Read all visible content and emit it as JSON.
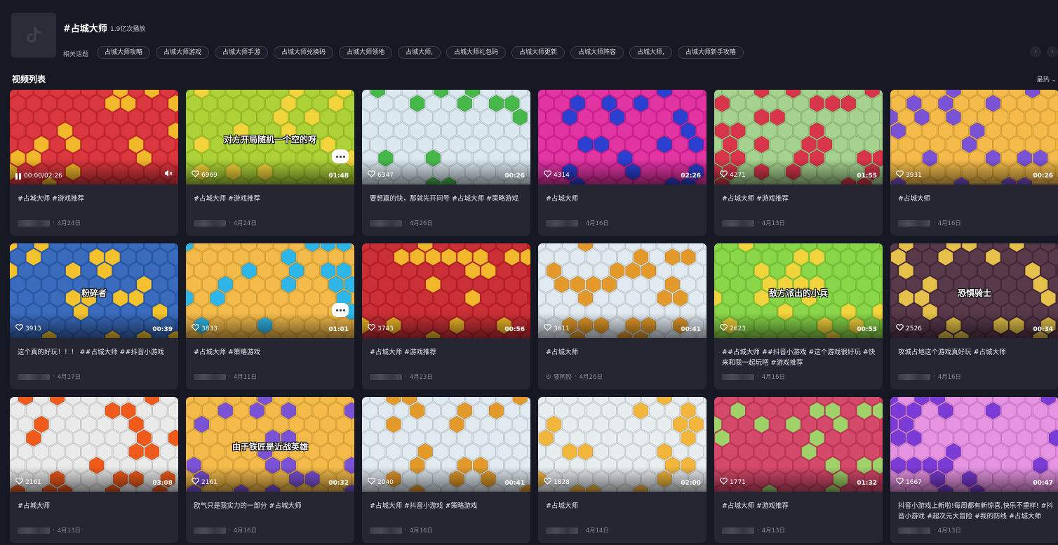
{
  "topic": {
    "title": "#占城大师",
    "plays": "1.9亿次播放",
    "related_label": "相关话题",
    "related_tags": [
      "占城大师攻略",
      "占城大师游戏",
      "占城大师手游",
      "占城大师兑换码",
      "占城大师领地",
      "占城大师,",
      "占城大师礼包码",
      "占城大师更新",
      "占城大师阵容",
      "占城大师,",
      "占城大师新手攻略"
    ],
    "prev_icon": "chevron-left-icon",
    "next_icon": "chevron-right-icon"
  },
  "section": {
    "title": "视频列表",
    "sort_label": "最热 ⌄"
  },
  "videos": [
    {
      "likes": "",
      "duration": "",
      "time": "00:00/02:26",
      "caption": "#占城大师 #游戏推荐",
      "author": "",
      "date": "4月24日",
      "overlay": "",
      "bg": "#d7262e",
      "accent": "#f0b82a",
      "playing": true,
      "bubble": false
    },
    {
      "likes": "6969",
      "duration": "01:48",
      "caption": "#占城大师 #游戏推荐",
      "author": "",
      "date": "4月24日",
      "overlay": "对方开局随机一个空的呀",
      "bg": "#a6cf28",
      "accent": "#f1d33b",
      "playing": false,
      "bubble": true
    },
    {
      "likes": "6347",
      "duration": "00:26",
      "caption": "要想赢的快，那就先开问号 #占城大师 #策略游戏",
      "author": "",
      "date": "4月26日",
      "overlay": "",
      "bg": "#d8e6ee",
      "accent": "#46b84a",
      "playing": false,
      "bubble": false
    },
    {
      "likes": "4314",
      "duration": "02:26",
      "caption": "#占城大师",
      "author": "",
      "date": "4月16日",
      "overlay": "",
      "bg": "#e0239c",
      "accent": "#2b3fd1",
      "playing": false,
      "bubble": false
    },
    {
      "likes": "4271",
      "duration": "01:55",
      "caption": "#占城大师 #游戏推荐",
      "author": "",
      "date": "4月13日",
      "overlay": "",
      "bg": "#9fcf86",
      "accent": "#d8354b",
      "playing": false,
      "bubble": false
    },
    {
      "likes": "3931",
      "duration": "00:26",
      "caption": "#占城大师",
      "author": "",
      "date": "4月16日",
      "overlay": "",
      "bg": "#f3b63c",
      "accent": "#7a52d6",
      "playing": false,
      "bubble": false
    },
    {
      "likes": "3913",
      "duration": "00:39",
      "caption": "这个真的好玩！！！ ##占城大师 ##抖音小游戏",
      "author": "",
      "date": "4月17日",
      "overlay": "粉碎者",
      "bg": "#2a5fb8",
      "accent": "#f4c22d",
      "playing": false,
      "bubble": false
    },
    {
      "likes": "3833",
      "duration": "01:01",
      "caption": "#占城大师 #策略游戏",
      "author": "",
      "date": "4月11日",
      "overlay": "",
      "bg": "#f3b63c",
      "accent": "#2fb6e8",
      "playing": false,
      "bubble": true
    },
    {
      "likes": "3743",
      "duration": "00:56",
      "caption": "#占城大师 #游戏推荐",
      "author": "",
      "date": "4月23日",
      "overlay": "",
      "bg": "#c71f26",
      "accent": "#f0b82a",
      "playing": false,
      "bubble": false
    },
    {
      "likes": "3611",
      "duration": "00:41",
      "caption": "#占城大师",
      "author": "要阿胶",
      "date": "4月26日",
      "overlay": "",
      "bg": "#dfe9ef",
      "accent": "#e39a2a",
      "playing": false,
      "bubble": false
    },
    {
      "likes": "2623",
      "duration": "00:53",
      "caption": "##占城大师 ##抖音小游戏 #这个游戏很好玩 #快来和我一起玩吧 #游戏推荐",
      "author": "",
      "date": "4月16日",
      "overlay": "敌方派出的小兵",
      "bg": "#7fd43a",
      "accent": "#f1d33b",
      "playing": false,
      "bubble": false
    },
    {
      "likes": "2526",
      "duration": "00:34",
      "caption": "攻城占地这个游戏真好玩 #占城大师",
      "author": "",
      "date": "4月16日",
      "overlay": "恐惧骑士",
      "bg": "#4a2a3c",
      "accent": "#e5c04a",
      "playing": false,
      "bubble": false
    },
    {
      "likes": "2161",
      "duration": "03:08",
      "caption": "#占城大师",
      "author": "",
      "date": "4月13日",
      "overlay": "",
      "bg": "#e9e9e9",
      "accent": "#f05a1a",
      "playing": false,
      "bubble": false
    },
    {
      "likes": "2161",
      "duration": "00:32",
      "caption": "欧气只是我实力的一部分 #占城大师",
      "author": "",
      "date": "4月16日",
      "overlay": "由于铁匠是近战英雄",
      "bg": "#f3b63c",
      "accent": "#7a52d6",
      "playing": false,
      "bubble": false
    },
    {
      "likes": "2040",
      "duration": "00:41",
      "caption": "#占城大师 #抖音小游戏 #策略游戏",
      "author": "",
      "date": "4月16日",
      "overlay": "",
      "bg": "#dfe9ef",
      "accent": "#e39a2a",
      "playing": false,
      "bubble": false
    },
    {
      "likes": "1828",
      "duration": "02:00",
      "caption": "#占城大师",
      "author": "",
      "date": "4月14日",
      "overlay": "",
      "bg": "#e6ecef",
      "accent": "#f3b63c",
      "playing": false,
      "bubble": false
    },
    {
      "likes": "1771",
      "duration": "01:32",
      "caption": "#占城大师 #游戏推荐",
      "author": "",
      "date": "4月13日",
      "overlay": "",
      "bg": "#d23a5e",
      "accent": "#9fd36a",
      "playing": false,
      "bubble": false
    },
    {
      "likes": "1667",
      "duration": "00:47",
      "caption": "抖音小游戏上新啦!每周都有新惊喜,快乐不重样! #抖音小游戏 #超次元大冒险 #我的防线 #占城大师",
      "author": "",
      "date": "4月13日",
      "overlay": "",
      "bg": "#e48ae0",
      "accent": "#7a3bd6",
      "playing": false,
      "bubble": false
    }
  ]
}
